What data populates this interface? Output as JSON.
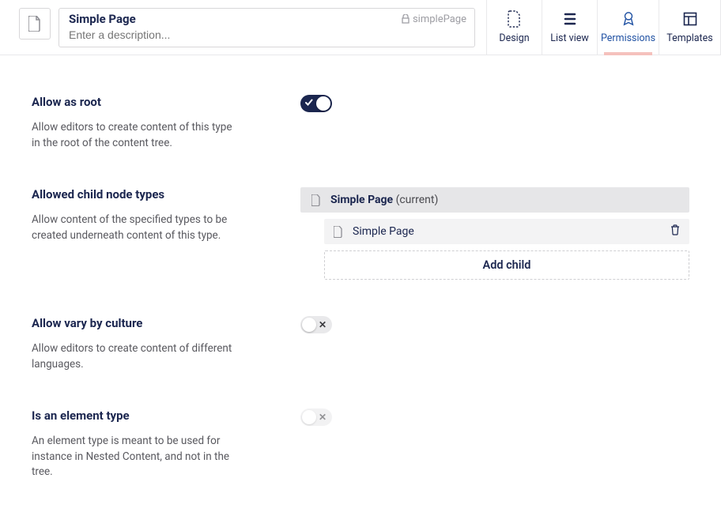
{
  "header": {
    "name": "Simple Page",
    "alias": "simplePage",
    "description_placeholder": "Enter a description..."
  },
  "tabs": [
    {
      "id": "design",
      "label": "Design",
      "icon": "file-dashed"
    },
    {
      "id": "listview",
      "label": "List view",
      "icon": "list"
    },
    {
      "id": "permissions",
      "label": "Permissions",
      "icon": "rosette",
      "active": true
    },
    {
      "id": "templates",
      "label": "Templates",
      "icon": "layout"
    }
  ],
  "fields": {
    "allow_root": {
      "title": "Allow as root",
      "desc": "Allow editors to create content of this type in the root of the content tree.",
      "value": true
    },
    "allowed_children": {
      "title": "Allowed child node types",
      "desc": "Allow content of the specified types to be created underneath content of this type.",
      "parent": {
        "name": "Simple Page",
        "suffix": "(current)"
      },
      "items": [
        {
          "name": "Simple Page"
        }
      ],
      "add_label": "Add child"
    },
    "vary_culture": {
      "title": "Allow vary by culture",
      "desc": "Allow editors to create content of different languages.",
      "value": false
    },
    "element_type": {
      "title": "Is an element type",
      "desc": "An element type is meant to be used for instance in Nested Content, and not in the tree.",
      "value": false,
      "disabled": true
    }
  }
}
